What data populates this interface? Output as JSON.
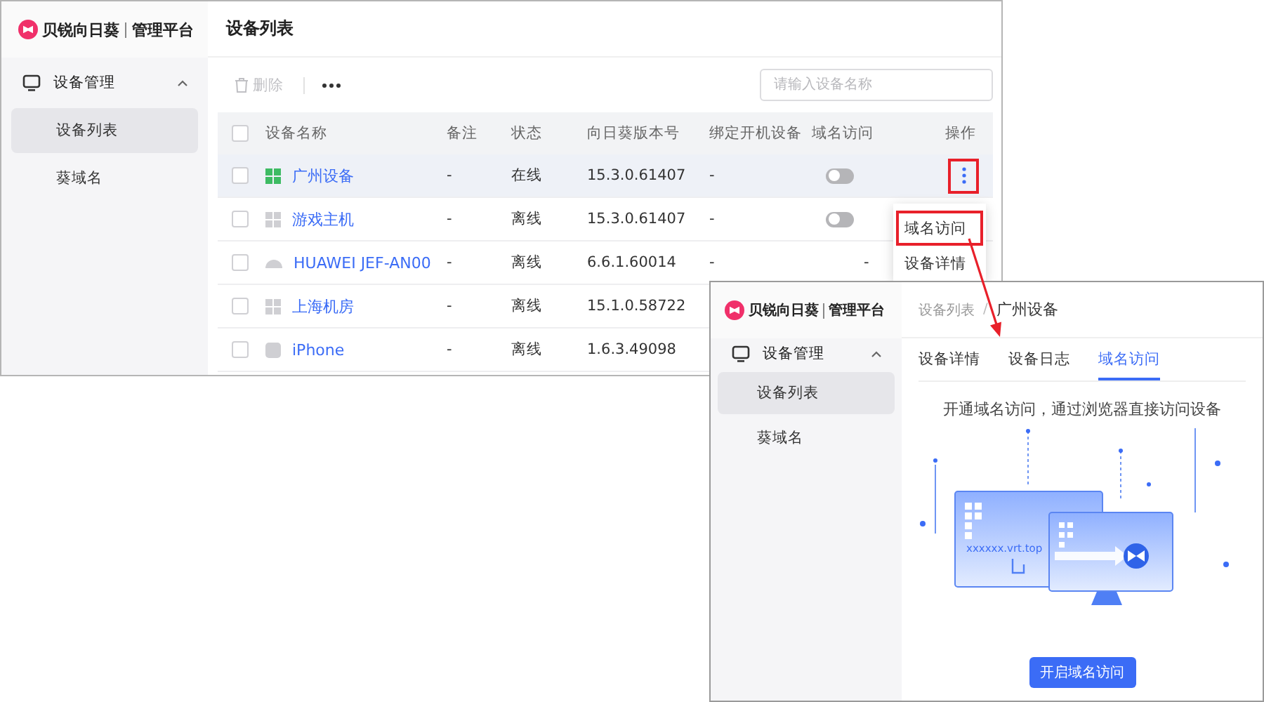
{
  "list_window": {
    "logo": {
      "brand": "贝锐向日葵",
      "product": "管理平台"
    },
    "sidebar": {
      "group": {
        "label": "设备管理",
        "expanded": true
      },
      "items": [
        {
          "label": "设备列表",
          "selected": true
        },
        {
          "label": "葵域名",
          "selected": false
        }
      ]
    },
    "title": "设备列表",
    "toolbar": {
      "delete": {
        "label": "删除",
        "disabled": true
      }
    },
    "search": {
      "placeholder": "请输入设备名称"
    },
    "table": {
      "select_all": {
        "checked": false
      },
      "columns": [
        "设备名称",
        "备注",
        "状态",
        "向日葵版本号",
        "绑定开机设备",
        "域名访问",
        "操作"
      ],
      "rows": [
        {
          "checked": false,
          "highlighted": true,
          "kind": "windows",
          "online": true,
          "name": "广州设备",
          "note": "-",
          "status": "在线",
          "version": "15.3.0.61407",
          "bound": "-",
          "domain_access": {
            "kind": "toggle",
            "on": false
          },
          "actions": {
            "annotated": true
          }
        },
        {
          "checked": false,
          "highlighted": false,
          "kind": "windows",
          "online": false,
          "name": "游戏主机",
          "note": "-",
          "status": "离线",
          "version": "15.3.0.61407",
          "bound": "-",
          "domain_access": {
            "kind": "toggle",
            "on": false
          }
        },
        {
          "checked": false,
          "highlighted": false,
          "kind": "android",
          "online": false,
          "name": "HUAWEI JEF-AN00",
          "note": "-",
          "status": "离线",
          "version": "6.6.1.60014",
          "bound": "-",
          "domain_access": {
            "kind": "text",
            "text": "-"
          }
        },
        {
          "checked": false,
          "highlighted": false,
          "kind": "windows",
          "online": false,
          "name": "上海机房",
          "note": "-",
          "status": "离线",
          "version": "15.1.0.58722"
        },
        {
          "checked": false,
          "highlighted": false,
          "kind": "ios",
          "online": false,
          "name": "iPhone",
          "note": "-",
          "status": "离线",
          "version": "1.6.3.49098"
        }
      ]
    },
    "menu": {
      "items": [
        {
          "label": "域名访问",
          "annotated": true
        },
        {
          "label": "设备详情",
          "annotated": false
        }
      ]
    }
  },
  "detail_window": {
    "logo": {
      "brand": "贝锐向日葵",
      "product": "管理平台"
    },
    "sidebar": {
      "group": {
        "label": "设备管理",
        "expanded": true
      },
      "items": [
        {
          "label": "设备列表",
          "selected": true
        },
        {
          "label": "葵域名",
          "selected": false
        }
      ]
    },
    "breadcrumb": {
      "items": [
        "设备列表",
        "广州设备"
      ],
      "separator": "/"
    },
    "tabs": [
      {
        "label": "设备详情",
        "selected": false
      },
      {
        "label": "设备日志",
        "selected": false
      },
      {
        "label": "域名访问",
        "selected": true
      }
    ],
    "message": "开通域名访问，通过浏览器直接访问设备",
    "illustration": {
      "url": "xxxxxx.vrt.top"
    },
    "button": "开启域名访问"
  }
}
